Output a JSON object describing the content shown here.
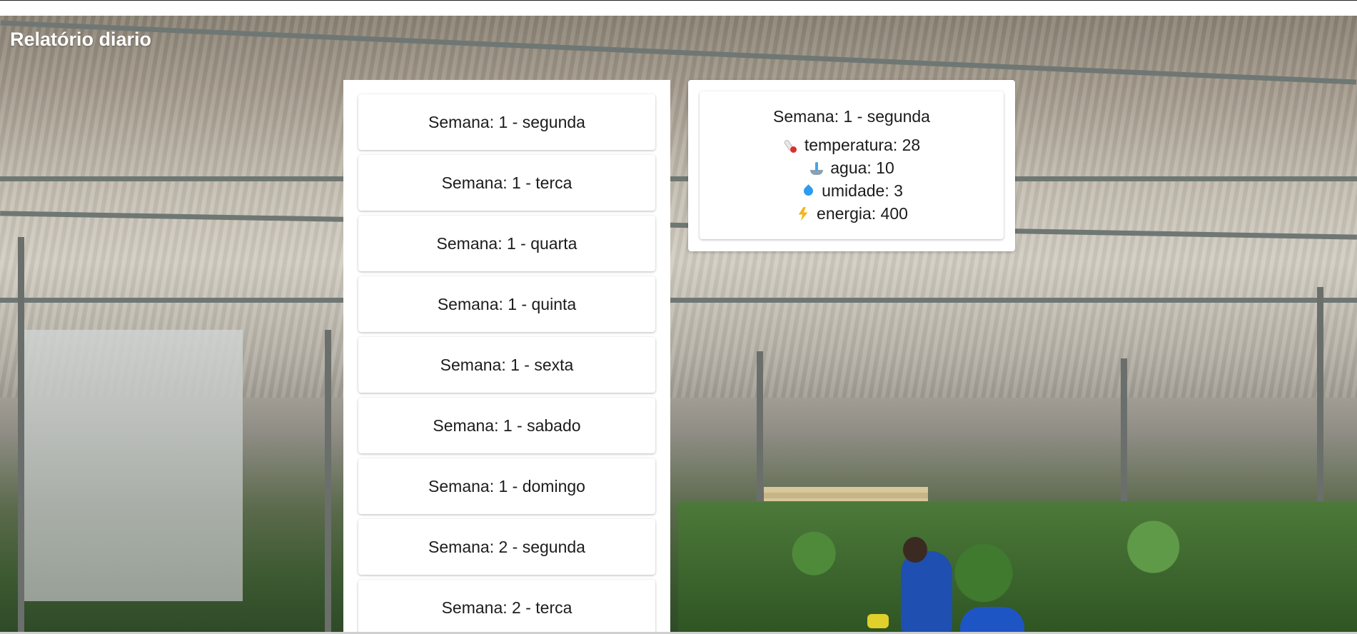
{
  "header": {
    "title": "Relatório diario"
  },
  "days": [
    {
      "label": "Semana: 1 - segunda"
    },
    {
      "label": "Semana: 1 - terca"
    },
    {
      "label": "Semana: 1 - quarta"
    },
    {
      "label": "Semana: 1 - quinta"
    },
    {
      "label": "Semana: 1 - sexta"
    },
    {
      "label": "Semana: 1 - sabado"
    },
    {
      "label": "Semana: 1 - domingo"
    },
    {
      "label": "Semana: 2 - segunda"
    },
    {
      "label": "Semana: 2 - terca"
    }
  ],
  "detail": {
    "title": "Semana: 1 - segunda",
    "metrics": [
      {
        "icon": "thermometer-icon",
        "text": "temperatura: 28"
      },
      {
        "icon": "fountain-icon",
        "text": "agua: 10"
      },
      {
        "icon": "droplet-icon",
        "text": "umidade: 3"
      },
      {
        "icon": "lightning-icon",
        "text": "energia: 400"
      }
    ]
  }
}
